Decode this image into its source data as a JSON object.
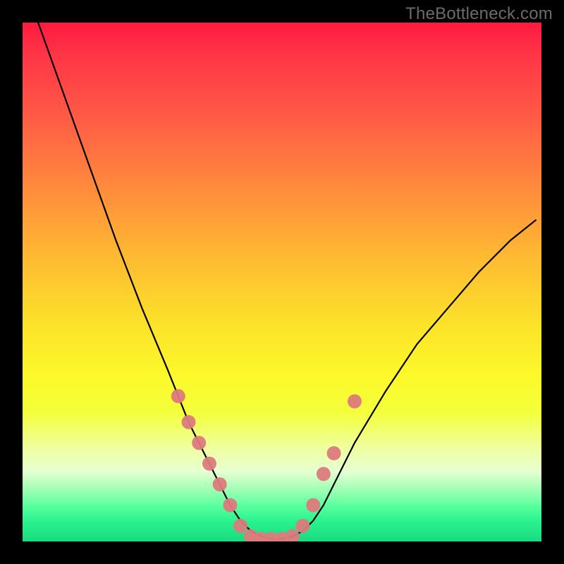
{
  "watermark": "TheBottleneck.com",
  "chart_data": {
    "type": "line",
    "title": "",
    "xlabel": "",
    "ylabel": "",
    "xlim": [
      0,
      100
    ],
    "ylim": [
      0,
      100
    ],
    "grid": false,
    "legend": false,
    "series": [
      {
        "name": "bottleneck-curve",
        "color": "#000000",
        "x": [
          3,
          8,
          13,
          18,
          23,
          28,
          30,
          32,
          34,
          36,
          38,
          40,
          42,
          44,
          46,
          48,
          50,
          52,
          54,
          56,
          58,
          60,
          64,
          70,
          76,
          82,
          88,
          94,
          99
        ],
        "y": [
          100,
          86,
          72,
          58,
          45,
          33,
          28,
          23,
          19,
          15,
          11,
          7,
          4,
          2,
          1,
          0.5,
          0.5,
          1,
          2,
          4,
          7,
          11,
          19,
          29,
          38,
          45,
          52,
          58,
          62
        ]
      },
      {
        "name": "hotspot-markers",
        "color": "#dd7a7d",
        "marker_only": true,
        "x": [
          30,
          32,
          34,
          36,
          38,
          40,
          42,
          44,
          46,
          48,
          50,
          52,
          54,
          56,
          58,
          60,
          64
        ],
        "y": [
          28,
          23,
          19,
          15,
          11,
          7,
          3,
          1,
          0.5,
          0.5,
          0.5,
          1,
          3,
          7,
          13,
          17,
          27
        ]
      }
    ],
    "background_gradient": {
      "direction": "vertical",
      "stops": [
        {
          "pos": 0.0,
          "color": "#ff1a3f"
        },
        {
          "pos": 0.25,
          "color": "#ff7b3e"
        },
        {
          "pos": 0.55,
          "color": "#fbe62a"
        },
        {
          "pos": 0.82,
          "color": "#efffa0"
        },
        {
          "pos": 0.9,
          "color": "#9fffb4"
        },
        {
          "pos": 1.0,
          "color": "#18db80"
        }
      ]
    }
  }
}
